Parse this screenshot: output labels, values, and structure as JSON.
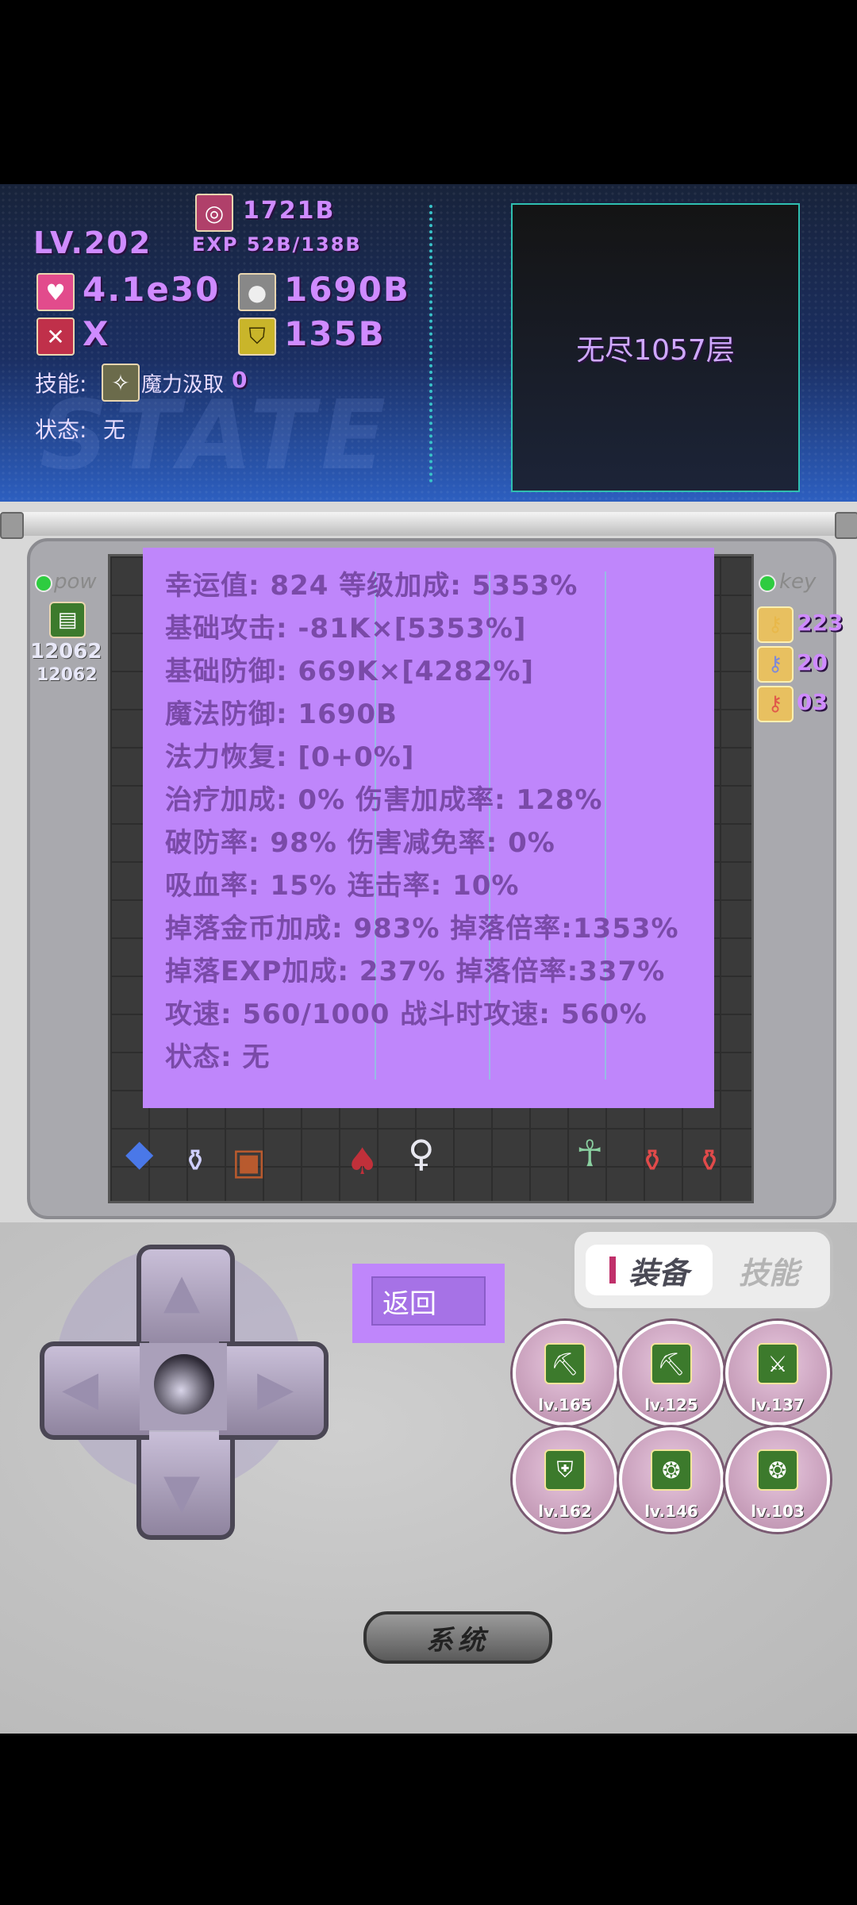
{
  "hero": {
    "level": "LV.202",
    "gold": "1721B",
    "exp": "EXP 52B/138B",
    "hp": "4.1e30",
    "attack_value": "1690B",
    "element": "X",
    "defense_value": "135B",
    "skill_label": "技能:",
    "skill_name": "魔力汲取",
    "skill_count": "0",
    "status_label": "状态:",
    "status_value": "无",
    "watermark": "STATE"
  },
  "floor": {
    "label": "无尽1057层"
  },
  "left_panel": {
    "label": "pow",
    "count_top": "12062",
    "count_bottom": "12062"
  },
  "right_panel": {
    "label": "key",
    "keys": [
      {
        "color": "#e8b84a",
        "count": "223"
      },
      {
        "color": "#7f8ad6",
        "count": "20"
      },
      {
        "color": "#e05a4a",
        "count": "03"
      }
    ]
  },
  "stats": [
    "幸运值: 824    等级加成: 5353%",
    "基础攻击: -81K×[5353%]",
    "基础防御: 669K×[4282%]",
    "魔法防御: 1690B",
    "法力恢复: [0+0%]",
    "治疗加成: 0%   伤害加成率: 128%",
    "破防率: 98%    伤害减免率: 0%",
    "吸血率: 15%    连击率: 10%",
    "掉落金币加成: 983% 掉落倍率:1353%",
    "掉落EXP加成: 237%  掉落倍率:337%",
    "攻速: 560/1000  战斗时攻速: 560%",
    "状态: 无"
  ],
  "controls": {
    "back_label": "返回",
    "tab_equip": "装备",
    "tab_skill": "技能",
    "system_label": "系统"
  },
  "equipment": [
    {
      "icon": "pickaxe-icon",
      "glyph": "⛏",
      "level": "lv.165"
    },
    {
      "icon": "pickaxe-icon",
      "glyph": "⛏",
      "level": "lv.125"
    },
    {
      "icon": "sword-icon",
      "glyph": "⚔",
      "level": "lv.137"
    },
    {
      "icon": "armor-icon",
      "glyph": "⛨",
      "level": "lv.162"
    },
    {
      "icon": "ring-icon",
      "glyph": "❂",
      "level": "lv.146"
    },
    {
      "icon": "ring-icon",
      "glyph": "❂",
      "level": "lv.103"
    }
  ]
}
